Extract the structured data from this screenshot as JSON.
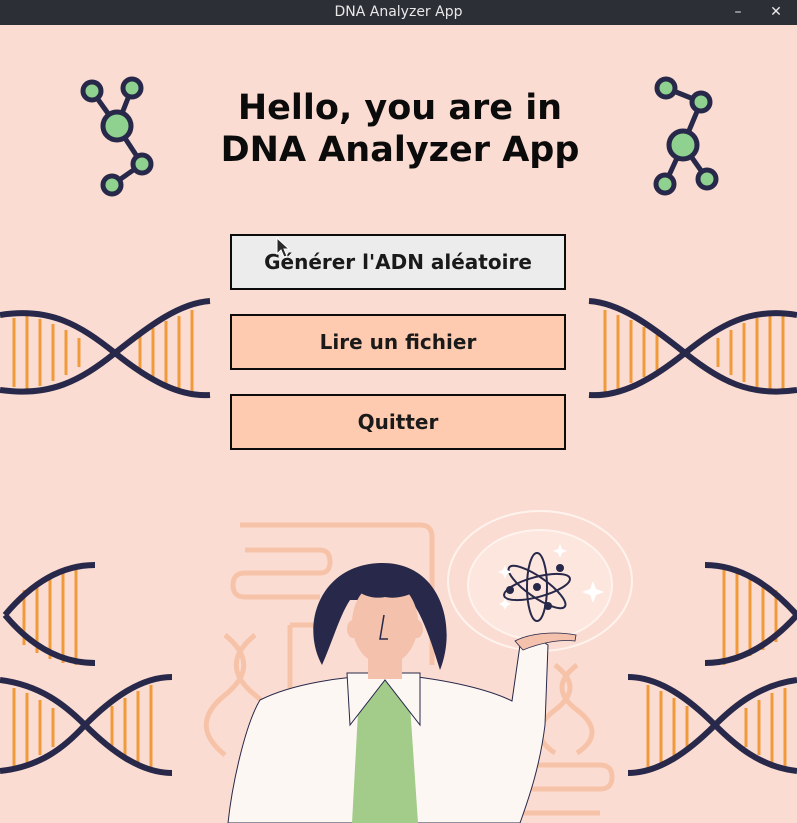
{
  "window": {
    "title": "DNA Analyzer App",
    "minimize_icon": "minimize-icon",
    "close_icon": "close-icon"
  },
  "main": {
    "heading_line1": "Hello, you are in",
    "heading_line2": "DNA Analyzer App",
    "buttons": {
      "generate": "Générer l'ADN aléatoire",
      "read_file": "Lire un fichier",
      "quit": "Quitter"
    }
  },
  "colors": {
    "background": "#fbdcd2",
    "button_primary": "#ececec",
    "button_secondary": "#ffcbb0",
    "dna_dark": "#27284a",
    "dna_rungs": "#f09a3a",
    "molecule_green": "#8fd18e"
  }
}
